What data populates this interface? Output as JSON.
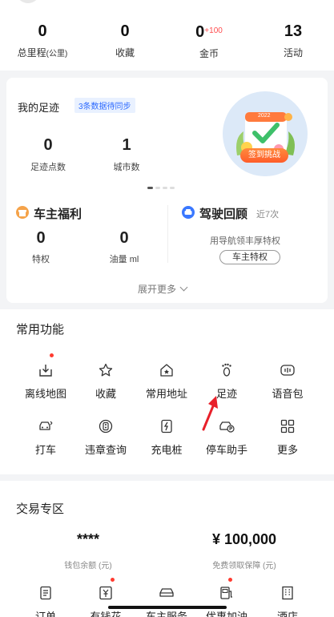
{
  "stats": [
    {
      "num": "0",
      "label": "总里程",
      "unit": "(公里)"
    },
    {
      "num": "0",
      "label": "收藏"
    },
    {
      "num": "0",
      "plus": "+100",
      "label": "金币"
    },
    {
      "num": "13",
      "label": "活动"
    }
  ],
  "footprint": {
    "title": "我的足迹",
    "sync_tag": "3条数据待同步",
    "points_num": "0",
    "points_label": "足迹点数",
    "cities_num": "1",
    "cities_label": "城市数",
    "badge_button": "签到挑战",
    "badge_year": "2022"
  },
  "benefits": {
    "owner_title": "车主福利",
    "privilege_num": "0",
    "privilege_label": "特权",
    "fuel_num": "0",
    "fuel_label": "油量 ml",
    "drive_title": "驾驶回顾",
    "recent": "近7次",
    "drive_desc": "用导航领丰厚特权",
    "owner_btn": "车主特权",
    "expand": "展开更多"
  },
  "common": {
    "title": "常用功能",
    "items": [
      {
        "label": "离线地图",
        "icon": "offline-map-icon"
      },
      {
        "label": "收藏",
        "icon": "star-icon"
      },
      {
        "label": "常用地址",
        "icon": "home-star-icon"
      },
      {
        "label": "足迹",
        "icon": "footprint-icon"
      },
      {
        "label": "语音包",
        "icon": "voice-pack-icon"
      },
      {
        "label": "打车",
        "icon": "taxi-icon"
      },
      {
        "label": "违章查询",
        "icon": "violation-icon"
      },
      {
        "label": "充电桩",
        "icon": "charger-icon"
      },
      {
        "label": "停车助手",
        "icon": "parking-icon"
      },
      {
        "label": "更多",
        "icon": "grid-icon"
      }
    ]
  },
  "trade": {
    "title": "交易专区",
    "wallet_value": "****",
    "wallet_label": "钱包余额 (元)",
    "guarantee_value": "¥ 100,000",
    "guarantee_label": "免费领取保障 (元)",
    "items": [
      {
        "label": "订单",
        "icon": "order-icon"
      },
      {
        "label": "有钱花",
        "icon": "money-icon"
      },
      {
        "label": "车主服务",
        "icon": "car-service-icon"
      },
      {
        "label": "优惠加油",
        "icon": "fuel-icon"
      },
      {
        "label": "酒店",
        "icon": "hotel-icon"
      }
    ]
  },
  "colors": {
    "accent_blue": "#2f6bff",
    "red": "#ff3b30",
    "orange": "#ff6a2a"
  }
}
